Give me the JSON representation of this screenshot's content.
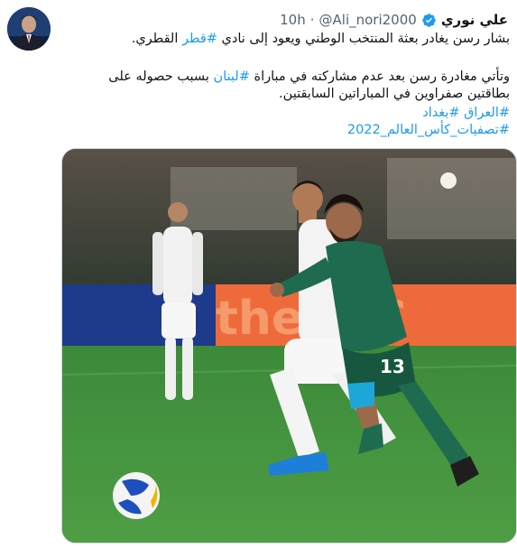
{
  "tweet": {
    "author": {
      "display_name": "علي نوري",
      "handle": "@Ali_nori2000",
      "verified": true,
      "avatar_icon": "user-avatar"
    },
    "separator": "·",
    "time": "10h",
    "lines": [
      {
        "parts": [
          {
            "text": "بشار رسن يغادر بعثة المنتخب الوطني ويعود إلى نادي ",
            "tag": false
          },
          {
            "text": "#قطر",
            "tag": true
          },
          {
            "text": " القطري.",
            "tag": false
          }
        ]
      },
      {
        "parts": [
          {
            "text": "وتأتي مغادرة رسن بعد عدم مشاركته في مباراة ",
            "tag": false
          },
          {
            "text": "#لبنان",
            "tag": true
          },
          {
            "text": " بسبب حصوله على",
            "tag": false
          }
        ]
      },
      {
        "parts": [
          {
            "text": "بطاقتين صفراوين في المباراتين السابقتين.",
            "tag": false
          }
        ]
      },
      {
        "parts": [
          {
            "text": "#العراق",
            "tag": true
          },
          {
            "text": " ",
            "tag": false
          },
          {
            "text": "#بغداد",
            "tag": true
          }
        ]
      },
      {
        "parts": [
          {
            "text": "#تصفيات_كأس_العالم_2022",
            "tag": true
          }
        ]
      }
    ],
    "media": {
      "board_text": "theAFC",
      "player_number": "13"
    },
    "colors": {
      "hashtag": "#1d9bf0",
      "verified": "#1d9bf0",
      "pitch": "#3f8a3a",
      "iraq_kit": "#1f6b4f",
      "iran_kit": "#f2f2f2"
    }
  }
}
